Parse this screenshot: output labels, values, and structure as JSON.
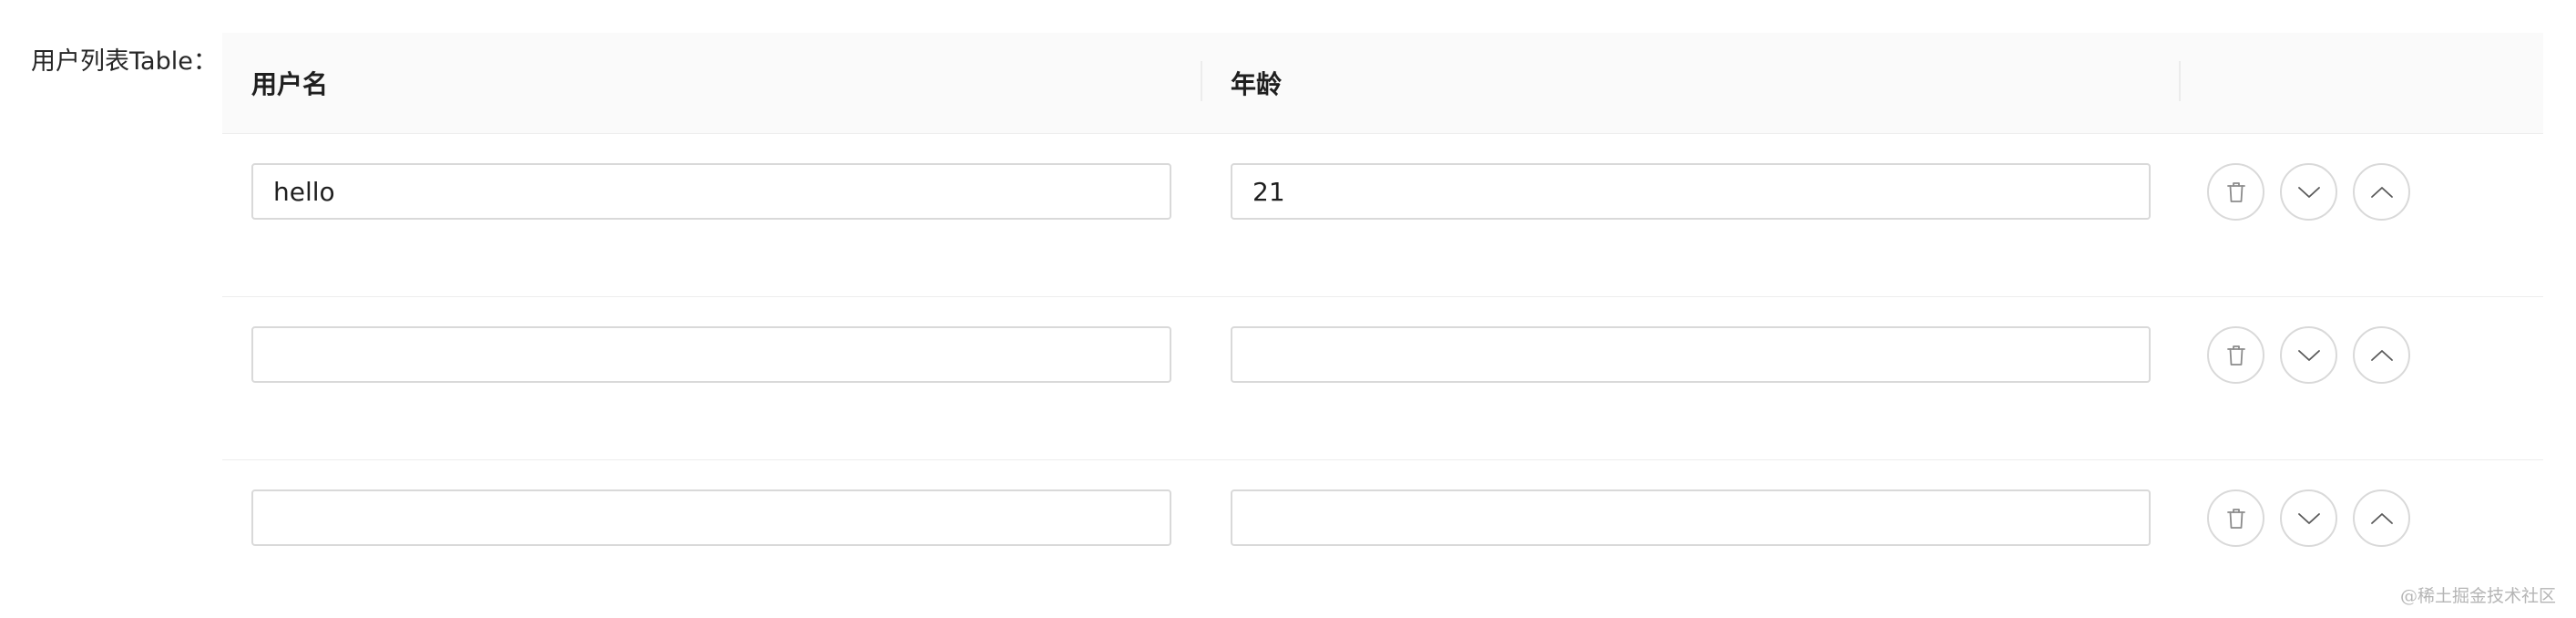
{
  "form": {
    "label": "用户列表Table："
  },
  "table": {
    "columns": [
      "用户名",
      "年龄",
      ""
    ],
    "rows": [
      {
        "username": "hello",
        "age": "21"
      },
      {
        "username": "",
        "age": ""
      },
      {
        "username": "",
        "age": ""
      }
    ],
    "row_actions": {
      "delete_icon": "trash-icon",
      "move_down_icon": "chevron-down-icon",
      "move_up_icon": "chevron-up-icon"
    }
  },
  "watermark": "@稀土掘金技术社区",
  "colors": {
    "border": "#d9d9d9",
    "header_bg": "#fafafa",
    "text": "#1f1f1f",
    "watermark": "#b5b5b5"
  }
}
